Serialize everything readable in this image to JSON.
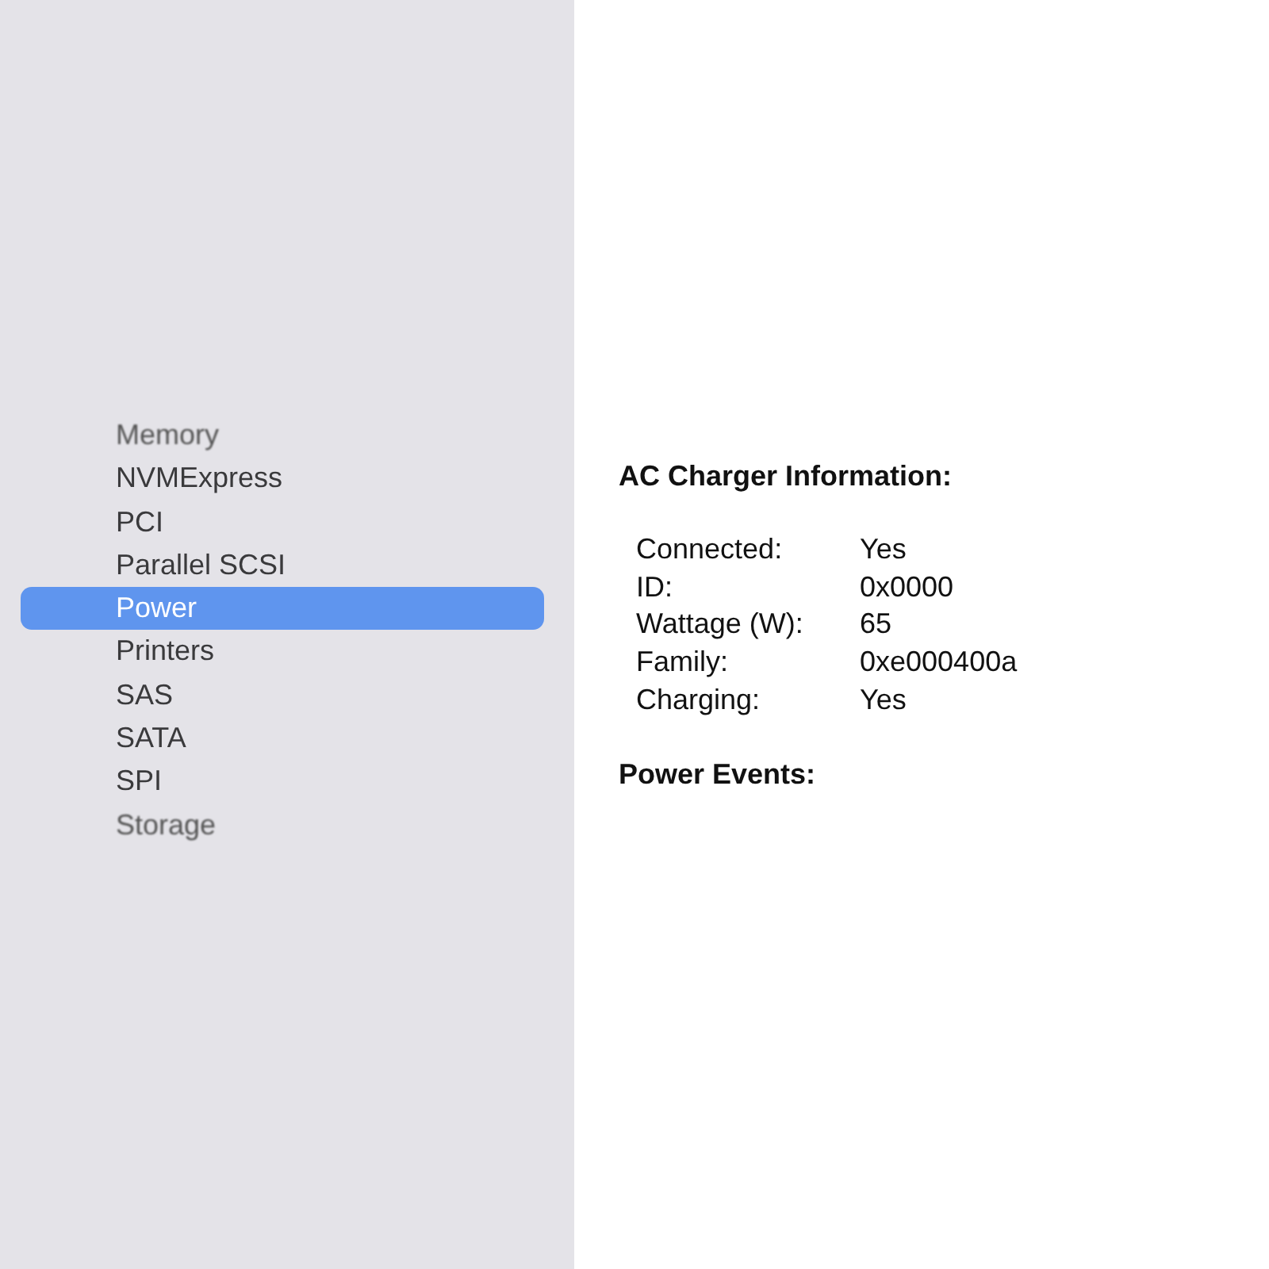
{
  "sidebar": {
    "items": [
      {
        "label": "Memory",
        "selected": false,
        "blurred": true
      },
      {
        "label": "NVMExpress",
        "selected": false,
        "blurred": false
      },
      {
        "label": "PCI",
        "selected": false,
        "blurred": false
      },
      {
        "label": "Parallel SCSI",
        "selected": false,
        "blurred": false
      },
      {
        "label": "Power",
        "selected": true,
        "blurred": false
      },
      {
        "label": "Printers",
        "selected": false,
        "blurred": false
      },
      {
        "label": "SAS",
        "selected": false,
        "blurred": false
      },
      {
        "label": "SATA",
        "selected": false,
        "blurred": false
      },
      {
        "label": "SPI",
        "selected": false,
        "blurred": false
      },
      {
        "label": "Storage",
        "selected": false,
        "blurred": true
      }
    ]
  },
  "detail": {
    "sections": [
      {
        "title": "AC Charger Information:",
        "rows": [
          {
            "label": "Connected:",
            "value": "Yes"
          },
          {
            "label": "ID:",
            "value": "0x0000"
          },
          {
            "label": "Wattage (W):",
            "value": "65"
          },
          {
            "label": "Family:",
            "value": "0xe000400a"
          },
          {
            "label": "Charging:",
            "value": "Yes"
          }
        ]
      },
      {
        "title": "Power Events:"
      }
    ]
  }
}
